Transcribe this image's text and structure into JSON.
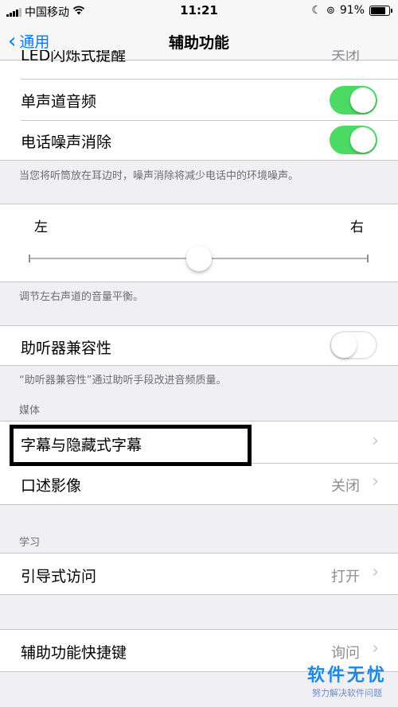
{
  "status_bar": {
    "carrier": "中国移动",
    "time": "11:21",
    "battery": "91%",
    "battery_level": 0.91
  },
  "nav": {
    "back_label": "通用",
    "title": "辅助功能"
  },
  "partial_row": {
    "label": "LED闪烁式提醒",
    "value": "关闭"
  },
  "audio_rows": [
    {
      "label": "单声道音频",
      "toggle": "on"
    },
    {
      "label": "电话噪声消除",
      "toggle": "on"
    }
  ],
  "noise_footnote": "当您将听筒放在耳边时，噪声消除将减少电话中的环境噪声。",
  "balance": {
    "left_label": "左",
    "right_label": "右",
    "position": 0.5
  },
  "balance_footnote": "调节左右声道的音量平衡。",
  "hearing": {
    "label": "助听器兼容性",
    "toggle": "off"
  },
  "hearing_footnote": "“助听器兼容性”通过助听手段改进音频质量。",
  "media_header": "媒体",
  "media_rows": [
    {
      "label": "字幕与隐藏式字幕",
      "value": ""
    },
    {
      "label": "口述影像",
      "value": "关闭"
    }
  ],
  "learning_header": "学习",
  "guided_access": {
    "label": "引导式访问",
    "value": "打开"
  },
  "shortcut": {
    "label": "辅助功能快捷键",
    "value": "询问"
  },
  "watermark": {
    "title": "软件无忧",
    "subtitle": "努力解决软件问题"
  },
  "colors": {
    "accent": "#007aff",
    "toggle_on": "#4cd964",
    "bg": "#efeff4"
  }
}
